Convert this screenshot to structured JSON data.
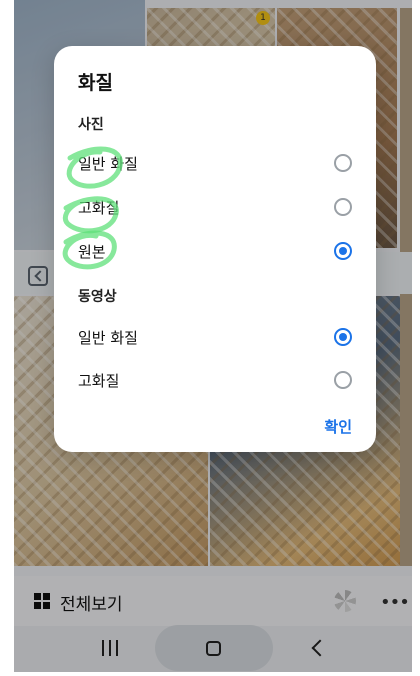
{
  "dialog": {
    "title": "화질",
    "sections": [
      {
        "label": "사진",
        "options": [
          {
            "label": "일반 화질",
            "selected": false
          },
          {
            "label": "고화질",
            "selected": false
          },
          {
            "label": "원본",
            "selected": true
          }
        ]
      },
      {
        "label": "동영상",
        "options": [
          {
            "label": "일반 화질",
            "selected": true
          },
          {
            "label": "고화질",
            "selected": false
          }
        ]
      }
    ],
    "confirm_label": "확인"
  },
  "background": {
    "badge_count": "1",
    "bottom_bar": {
      "view_all_label": "전체보기",
      "more_label": "•••"
    }
  },
  "colors": {
    "accent": "#1b73e8",
    "scribble": "#5fe07a"
  },
  "icons": [
    "grid-icon",
    "spinner-icon",
    "more-icon",
    "back-icon",
    "recents-icon",
    "home-icon",
    "nav-back-icon"
  ]
}
